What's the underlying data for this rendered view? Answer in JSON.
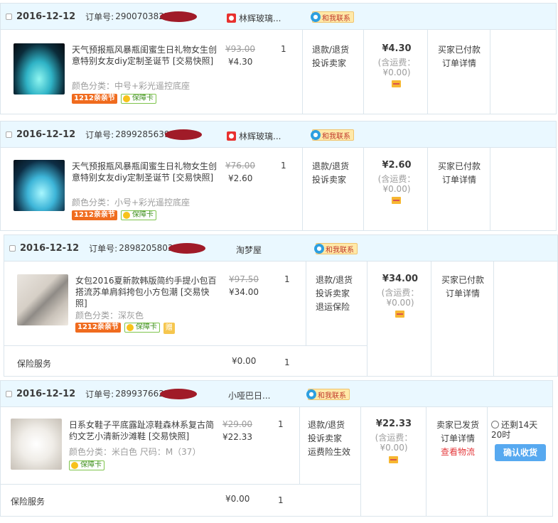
{
  "orders": [
    {
      "date": "2016-12-12",
      "order_no_label": "订单号:",
      "order_no": "2900703825",
      "shop": "林辉玻璃...",
      "contact": "和我联系",
      "item": {
        "title": "天气预报瓶风暴瓶闺蜜生日礼物女生创意特别女友diy定制圣诞节 [交易快照]",
        "spec": "颜色分类：中号+彩光遥控底座",
        "tags": [
          "1212亲亲节",
          "保障卡"
        ],
        "orig_price": "¥93.00",
        "price": "¥4.30",
        "qty": "1",
        "actions": [
          "退款/退货",
          "投诉卖家"
        ]
      },
      "total": "¥4.30",
      "shipping": "(含运费：¥0.00)",
      "status": [
        "买家已付款",
        "订单详情"
      ]
    },
    {
      "date": "2016-12-12",
      "order_no_label": "订单号:",
      "order_no": "28992856390",
      "shop": "林辉玻璃...",
      "contact": "和我联系",
      "item": {
        "title": "天气预报瓶风暴瓶闺蜜生日礼物女生创意特别女友diy定制圣诞节 [交易快照]",
        "spec": "颜色分类：小号+彩光遥控底座",
        "tags": [
          "1212亲亲节",
          "保障卡"
        ],
        "orig_price": "¥76.00",
        "price": "¥2.60",
        "qty": "1",
        "actions": [
          "退款/退货",
          "投诉卖家"
        ]
      },
      "total": "¥2.60",
      "shipping": "(含运费：¥0.00)",
      "status": [
        "买家已付款",
        "订单详情"
      ]
    },
    {
      "date": "2016-12-12",
      "order_no_label": "订单号:",
      "order_no": "28982058039",
      "shop": "淘梦屋",
      "contact": "和我联系",
      "item": {
        "title": "女包2016夏新款韩版简约手提小包百搭流苏单肩斜挎包小方包潮 [交易快照]",
        "spec": "颜色分类：深灰色",
        "tags": [
          "1212亲亲节",
          "保障卡",
          "赠"
        ],
        "orig_price": "¥97.50",
        "price": "¥34.00",
        "qty": "1",
        "actions": [
          "退款/退货",
          "投诉卖家",
          "退运保险"
        ]
      },
      "insurance": {
        "label": "保险服务",
        "price": "¥0.00",
        "qty": "1"
      },
      "total": "¥34.00",
      "shipping": "(含运费：¥0.00)",
      "status": [
        "买家已付款",
        "订单详情"
      ]
    },
    {
      "date": "2016-12-12",
      "order_no_label": "订单号:",
      "order_no": "2899376623",
      "shop": "小哑巴日...",
      "contact": "和我联系",
      "item": {
        "title": "日系女鞋子平底露趾凉鞋森林系复古简约文艺小清新沙滩鞋 [交易快照]",
        "spec": "颜色分类：米白色  尺码：M（37）",
        "tags": [
          "保障卡"
        ],
        "orig_price": "¥29.00",
        "price": "¥22.33",
        "qty": "1",
        "actions": [
          "退款/退货",
          "投诉卖家",
          "运费险生效"
        ]
      },
      "insurance": {
        "label": "保险服务",
        "price": "¥0.00",
        "qty": "1"
      },
      "total": "¥22.33",
      "shipping": "(含运费：¥0.00)",
      "status": [
        "卖家已发货",
        "订单详情",
        "查看物流"
      ],
      "countdown": "还剩14天20时",
      "confirm": "确认收货"
    }
  ]
}
